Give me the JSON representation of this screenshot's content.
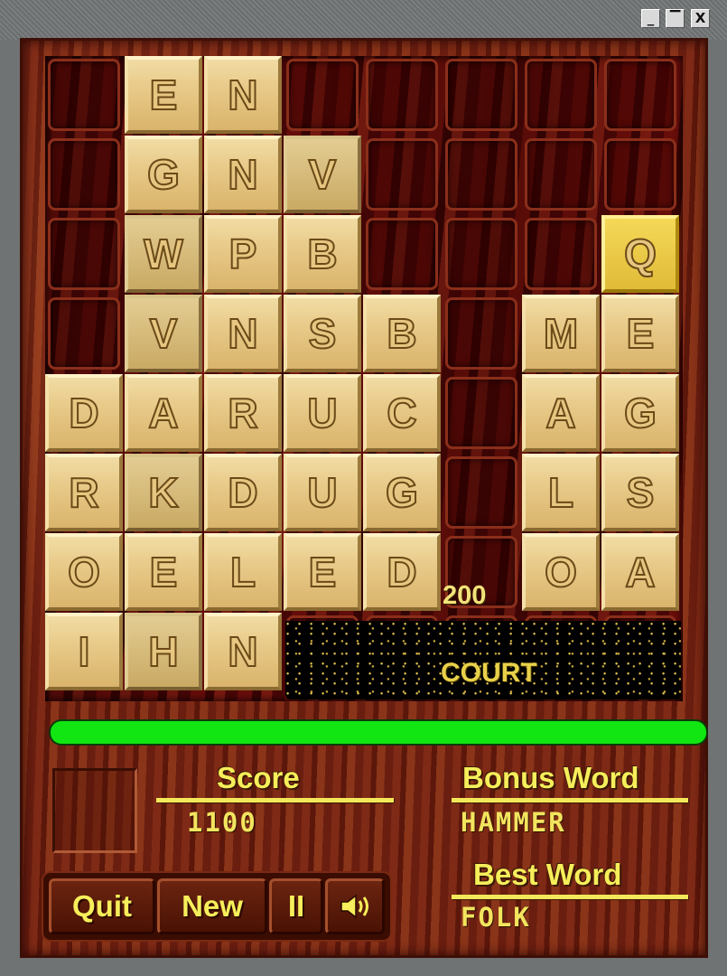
{
  "window": {
    "buttons": [
      "_",
      "▔",
      "X"
    ]
  },
  "grid": [
    [
      "",
      "E",
      "N",
      "",
      "",
      "",
      "",
      ""
    ],
    [
      "",
      "G",
      "N",
      "V",
      "",
      "",
      "",
      ""
    ],
    [
      "",
      "W",
      "P",
      "B",
      "",
      "",
      "",
      "Q"
    ],
    [
      "",
      "V",
      "N",
      "S",
      "B",
      "",
      "M",
      "E"
    ],
    [
      "D",
      "A",
      "R",
      "U",
      "C",
      "",
      "A",
      "G"
    ],
    [
      "R",
      "K",
      "D",
      "U",
      "G",
      "",
      "L",
      "S"
    ],
    [
      "O",
      "E",
      "L",
      "E",
      "D",
      "",
      "O",
      "A"
    ],
    [
      "I",
      "H",
      "N",
      "",
      "",
      "",
      "",
      ""
    ]
  ],
  "selected_tiles": [
    [
      2,
      1
    ],
    [
      3,
      1
    ],
    [
      5,
      1
    ],
    [
      7,
      1
    ],
    [
      1,
      3
    ]
  ],
  "gold_tile": [
    2,
    7
  ],
  "current_word": "COURT",
  "word_points": "200",
  "timer_fraction": 1.0,
  "score": {
    "label": "Score",
    "value": "1100"
  },
  "bonus_word": {
    "label": "Bonus Word",
    "value": "HAMMER"
  },
  "best_word": {
    "label": "Best Word",
    "value": "FOLK"
  },
  "controls": {
    "quit": "Quit",
    "new": "New",
    "pause": "II",
    "sound_icon": "speaker-icon"
  },
  "colors": {
    "timer": "#12e612",
    "label_text": "#f6ee5a",
    "tile": "#e7c886",
    "gold_tile": "#f0d24a"
  }
}
